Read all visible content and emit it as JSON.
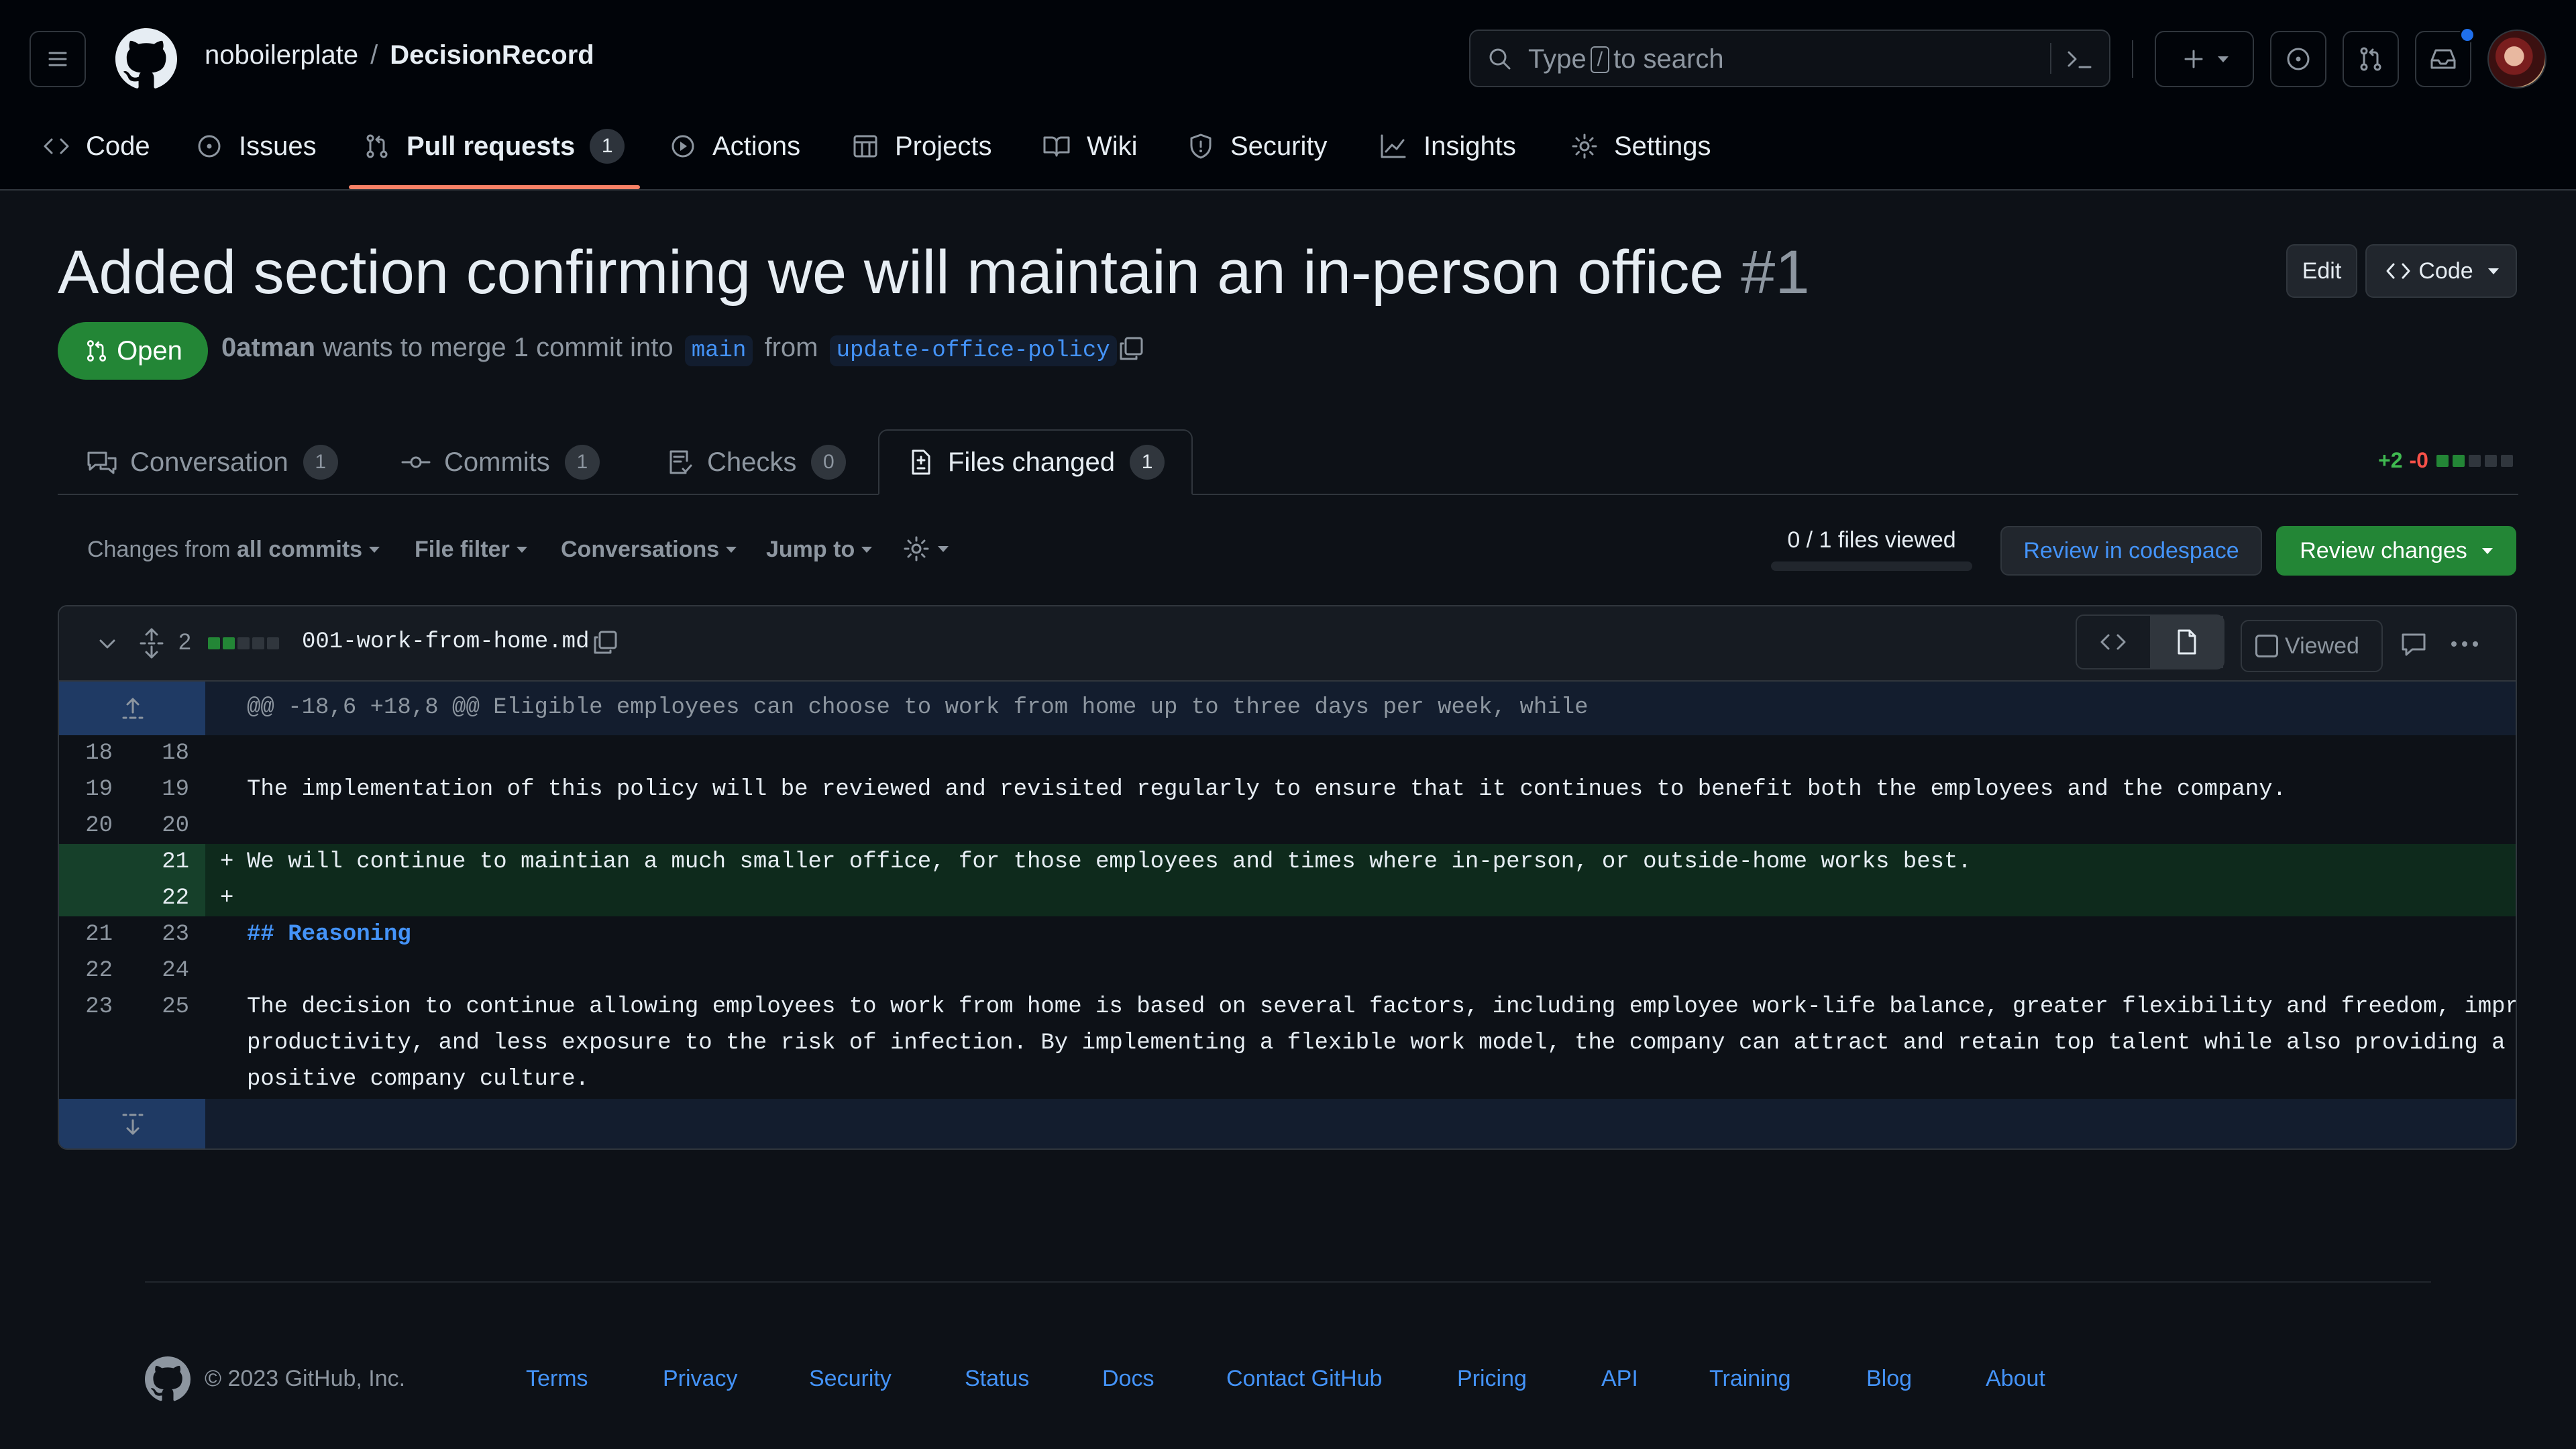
{
  "header": {
    "owner": "noboilerplate",
    "separator": "/",
    "repo": "DecisionRecord",
    "search_prefix": "Type",
    "search_key": "/",
    "search_suffix": "to search",
    "icons": [
      "hamburger-icon",
      "github-logo-icon",
      "search-icon",
      "command-palette-icon",
      "plus-icon",
      "issues-icon",
      "pull-requests-icon",
      "inbox-icon"
    ]
  },
  "nav": [
    {
      "label": "Code"
    },
    {
      "label": "Issues"
    },
    {
      "label": "Pull requests",
      "count": "1"
    },
    {
      "label": "Actions"
    },
    {
      "label": "Projects"
    },
    {
      "label": "Wiki"
    },
    {
      "label": "Security"
    },
    {
      "label": "Insights"
    },
    {
      "label": "Settings"
    }
  ],
  "pr": {
    "title": "Added section confirming we will maintain an in-person office",
    "number": "#1",
    "state": "Open",
    "author": "0atman",
    "merge_text": "wants to merge 1 commit into",
    "base": "main",
    "from_text": "from",
    "head": "update-office-policy",
    "edit_label": "Edit",
    "code_label": "Code"
  },
  "tabs": [
    {
      "label": "Conversation",
      "count": "1"
    },
    {
      "label": "Commits",
      "count": "1"
    },
    {
      "label": "Checks",
      "count": "0"
    },
    {
      "label": "Files changed",
      "count": "1"
    }
  ],
  "diffstat": {
    "additions": "+2",
    "deletions": "-0"
  },
  "toolbar": {
    "changes_from": "Changes from",
    "all_commits": "all commits",
    "file_filter": "File filter",
    "conversations": "Conversations",
    "jump_to": "Jump to",
    "files_viewed": "0 / 1 files viewed",
    "codespace": "Review in codespace",
    "review_changes": "Review changes"
  },
  "file": {
    "changes": "2",
    "name": "001-work-from-home.md",
    "viewed_label": "Viewed",
    "hunk": "@@ -18,6 +18,8 @@ Eligible employees can choose to work from home up to three days per week, while",
    "lines": [
      {
        "old": "18",
        "new": "18",
        "sign": "",
        "text": ""
      },
      {
        "old": "19",
        "new": "19",
        "sign": "",
        "text": "The implementation of this policy will be reviewed and revisited regularly to ensure that it continues to benefit both the employees and the company."
      },
      {
        "old": "20",
        "new": "20",
        "sign": "",
        "text": ""
      },
      {
        "old": "",
        "new": "21",
        "sign": "+",
        "text": "We will continue to maintian a much smaller office, for those employees and times where in-person, or outside-home works best."
      },
      {
        "old": "",
        "new": "22",
        "sign": "+",
        "text": ""
      },
      {
        "old": "21",
        "new": "23",
        "sign": "",
        "text": "## Reasoning"
      },
      {
        "old": "22",
        "new": "24",
        "sign": "",
        "text": ""
      },
      {
        "old": "23",
        "new": "25",
        "sign": "",
        "text": "The decision to continue allowing employees to work from home is based on several factors, including employee work-life balance, greater flexibility and freedom, improved",
        "text2": "productivity, and less exposure to the risk of infection. By implementing a flexible work model, the company can attract and retain top talent while also providing a",
        "text3": "positive company culture."
      }
    ]
  },
  "footer": {
    "copyright": "© 2023 GitHub, Inc.",
    "links": [
      "Terms",
      "Privacy",
      "Security",
      "Status",
      "Docs",
      "Contact GitHub",
      "Pricing",
      "API",
      "Training",
      "Blog",
      "About"
    ]
  },
  "colors": {
    "accent": "#4493f8",
    "success": "#238636",
    "active_tab_underline": "#f78166",
    "notification": "#1f6feb"
  }
}
